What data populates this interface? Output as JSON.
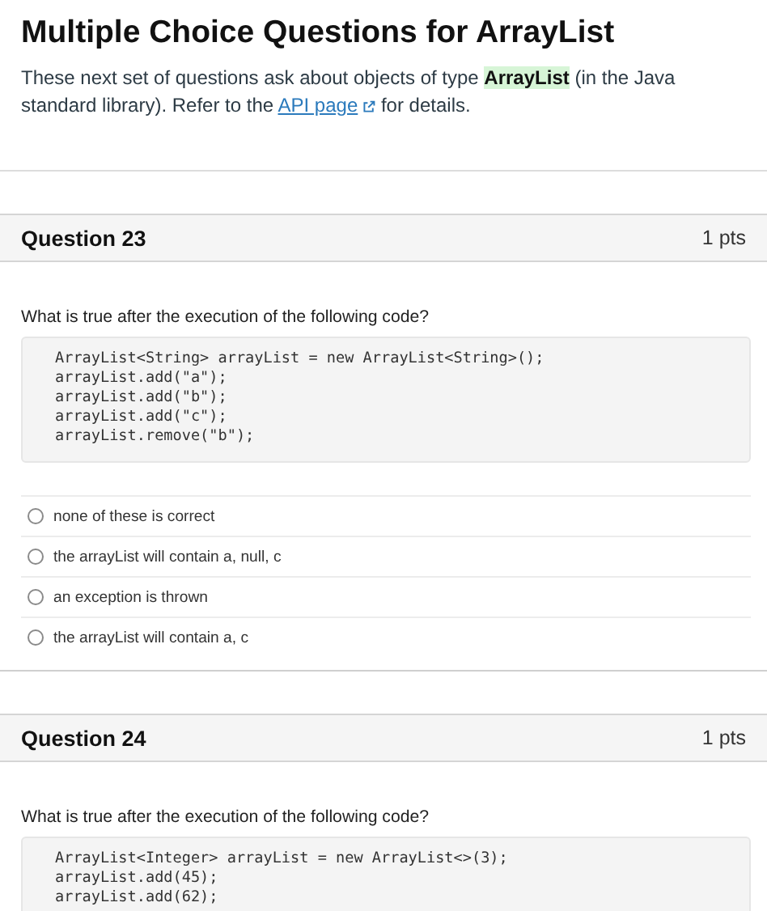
{
  "title": "Multiple Choice Questions for ArrayList",
  "intro": {
    "text_before": "These next set of questions ask about objects of type **ArrayList** (in the Java standard library). Refer to the ",
    "link": "API page",
    "text_after": " for details."
  },
  "questions": [
    {
      "title": "Question 23",
      "points": "1 pts",
      "prompt": "What is true after the execution of the following code?",
      "code": [
        "ArrayList<String> arrayList = new ArrayList<String>();",
        "arrayList.add(\"a\");",
        "arrayList.add(\"b\");",
        "arrayList.add(\"c\");",
        "arrayList.remove(\"b\");"
      ],
      "options": [
        {
          "label": "none of these is correct",
          "selected": false
        },
        {
          "label": "the arrayList will contain a, null, c",
          "selected": false
        },
        {
          "label": "an exception is thrown",
          "selected": false
        },
        {
          "label": "the arrayList will contain a, c",
          "selected": false
        }
      ]
    },
    {
      "title": "Question 24",
      "points": "1 pts",
      "prompt": "What is true after the execution of the following code?",
      "code": [
        "ArrayList<Integer> arrayList = new ArrayList<>(3);",
        "arrayList.add(45);",
        "arrayList.add(62);"
      ]
    }
  ]
}
